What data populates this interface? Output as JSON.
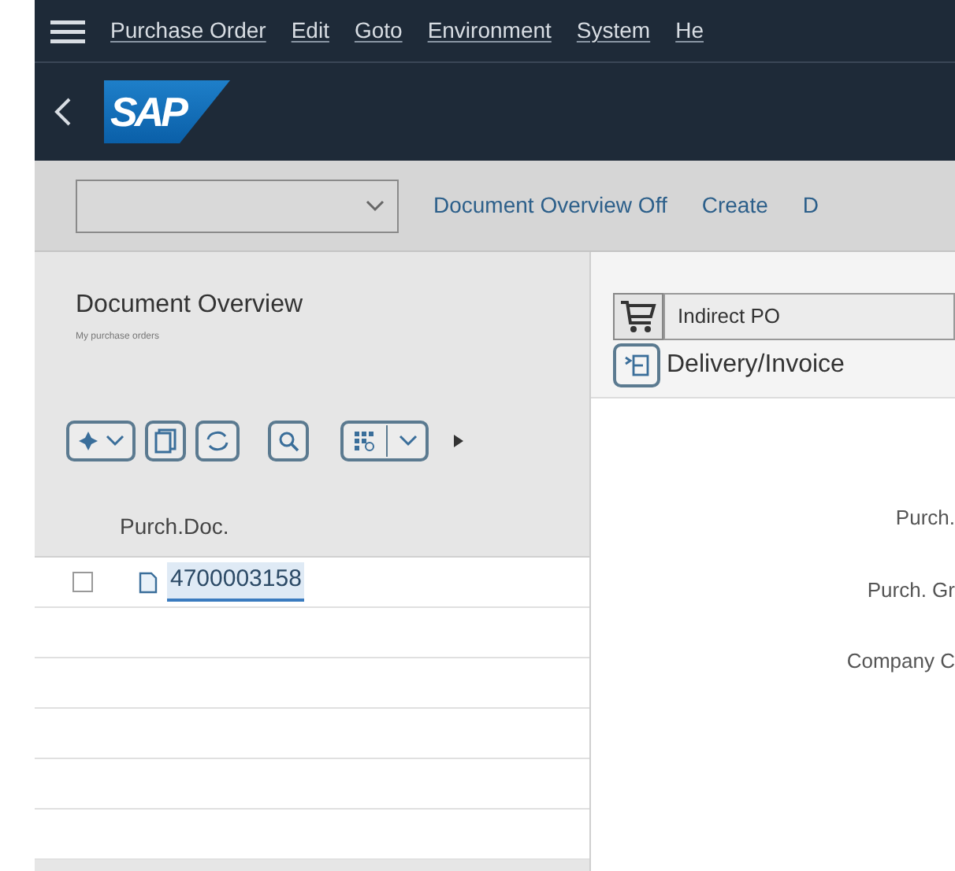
{
  "menu_bar": {
    "items": [
      "Purchase Order",
      "Edit",
      "Goto",
      "Environment",
      "System",
      "He"
    ]
  },
  "header": {
    "logo": "SAP"
  },
  "toolbar": {
    "buttons": [
      "Document Overview Off",
      "Create",
      "D"
    ]
  },
  "document_overview": {
    "title": "Document Overview",
    "subtitle": "My purchase orders",
    "table": {
      "columns": [
        "Purch.Doc."
      ],
      "rows": [
        {
          "checked": false,
          "doc": "4700003158",
          "selected": true
        }
      ]
    }
  },
  "detail": {
    "order_type": "Indirect PO",
    "section_button": "Delivery/Invoice",
    "labels": [
      "Purch.",
      "Purch. Gr",
      "Company C"
    ]
  }
}
